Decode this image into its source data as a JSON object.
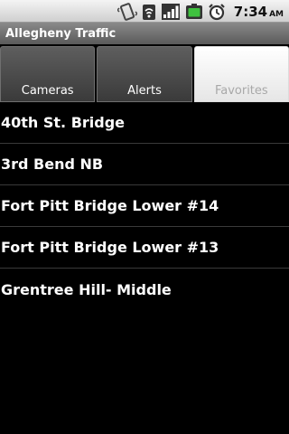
{
  "status_bar": {
    "time": "7:34",
    "ampm": "AM",
    "icons": [
      "vibrate-icon",
      "wifi-icon",
      "signal-icon",
      "battery-icon",
      "alarm-icon"
    ]
  },
  "app": {
    "title": "Allegheny Traffic"
  },
  "tabs": [
    {
      "label": "Cameras",
      "selected": false
    },
    {
      "label": "Alerts",
      "selected": false
    },
    {
      "label": "Favorites",
      "selected": true
    }
  ],
  "favorites": [
    {
      "label": "40th St. Bridge"
    },
    {
      "label": "3rd Bend NB"
    },
    {
      "label": "Fort Pitt Bridge Lower #14"
    },
    {
      "label": "Fort Pitt Bridge Lower #13"
    },
    {
      "label": "Grentree Hill- Middle"
    }
  ],
  "colors": {
    "background": "#000000",
    "title_bar": "#6e6e6e",
    "active_tab": "#f2f2f2",
    "inactive_tab": "#4a4a4a",
    "divider": "#3a3a3a"
  }
}
